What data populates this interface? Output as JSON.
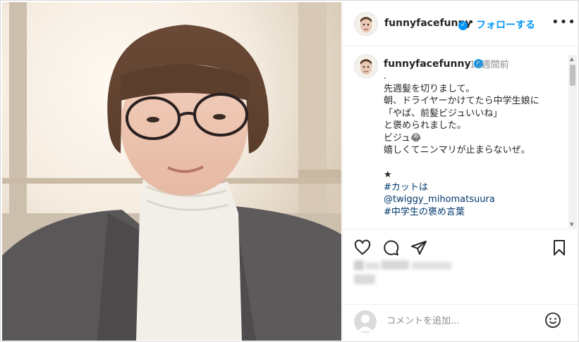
{
  "post": {
    "username": "funnyfacefunny",
    "verified_icon": "verified-badge-icon",
    "separator": "•",
    "follow_label": "フォローする",
    "more_icon": "more-options-icon",
    "time": "10週間前",
    "caption_lines": [
      ".",
      "先週髪を切りまして。",
      "朝、ドライヤーかけてたら中学生娘に",
      "「やば、前髪ビジュいいね」",
      "と褒められました。",
      "ビジュ😂",
      "嬉しくてニンマリが止まらないぜ。",
      "",
      "★",
      "#カットは",
      "@twiggy_mihomatsuura",
      "#中学生の褒め言葉"
    ],
    "comment_placeholder": "コメントを追加...",
    "accent_color": "#0095f6",
    "link_color": "#00376b",
    "icons": [
      "heart-icon",
      "comment-icon",
      "share-icon",
      "bookmark-icon",
      "emoji-icon"
    ]
  }
}
